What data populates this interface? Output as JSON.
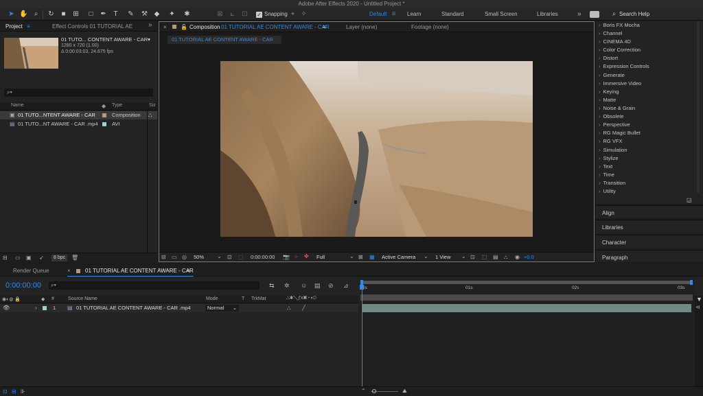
{
  "app": {
    "title": "Adobe After Effects 2020 - Untitled Project *"
  },
  "toolbar": {
    "snapping_label": "Snapping",
    "workspaces": [
      "Default",
      "Learn",
      "Standard",
      "Small Screen",
      "Libraries"
    ],
    "more_label": "»",
    "search_placeholder": "Search Help"
  },
  "project_panel": {
    "tabs": [
      "Project",
      "Effect Controls 01 TUTORIAL AE"
    ],
    "more_label": "»",
    "item_name": "01 TUTO... CONTENT AWARE - CAR▾",
    "item_dims": "1280 x 720 (1.00)",
    "item_duration": "Δ 0:00:03:03, 24.675 fps",
    "columns": {
      "name": "Name",
      "type": "Type",
      "size": "Siz"
    },
    "rows": [
      {
        "name": "01 TUTO...NTENT AWARE - CAR",
        "type": "Composition",
        "color": "#b49a78"
      },
      {
        "name": "01 TUTO...NT AWARE - CAR .mp4",
        "type": "AVI",
        "color": "#9cd2d2"
      }
    ],
    "bpc": "8 bpc"
  },
  "comp_panel": {
    "tab_prefix": "Composition",
    "tab_name": "01 TUTORIAL AE CONTENT AWARE - CAR",
    "layer_tab": "Layer (none)",
    "footage_tab": "Footage (none)",
    "breadcrumb": "01 TUTORIAL AE CONTENT AWARE - CAR",
    "zoom": "50%",
    "timecode": "0:00:00:00",
    "resolution": "Full",
    "camera": "Active Camera",
    "views": "1 View",
    "exposure": "+0.0"
  },
  "effects_list": [
    "Boris FX Mocha",
    "Channel",
    "CINEMA 4D",
    "Color Correction",
    "Distort",
    "Expression Controls",
    "Generate",
    "Immersive Video",
    "Keying",
    "Matte",
    "Noise & Grain",
    "Obsolete",
    "Perspective",
    "RG Magic Bullet",
    "RG VFX",
    "Simulation",
    "Stylize",
    "Text",
    "Time",
    "Transition",
    "Utility"
  ],
  "right_panels": [
    "Align",
    "Libraries",
    "Character",
    "Paragraph"
  ],
  "timeline": {
    "render_queue_tab": "Render Queue",
    "comp_tab": "01 TUTORIAL AE CONTENT AWARE - CAR",
    "timecode": "0:00:00:00",
    "columns": {
      "num": "#",
      "source": "Source Name",
      "mode": "Mode",
      "t": "T",
      "trkmat": "TrkMat"
    },
    "ruler": [
      "0s",
      "01s",
      "02s",
      "03s"
    ],
    "layer": {
      "num": "1",
      "name": "01 TUTORIAL AE CONTENT AWARE - CAR .mp4",
      "mode": "Normal",
      "color": "#9cd2d2"
    },
    "colors": {
      "accent": "#2d8ceb",
      "layer_bar": "#6f8a85"
    }
  }
}
